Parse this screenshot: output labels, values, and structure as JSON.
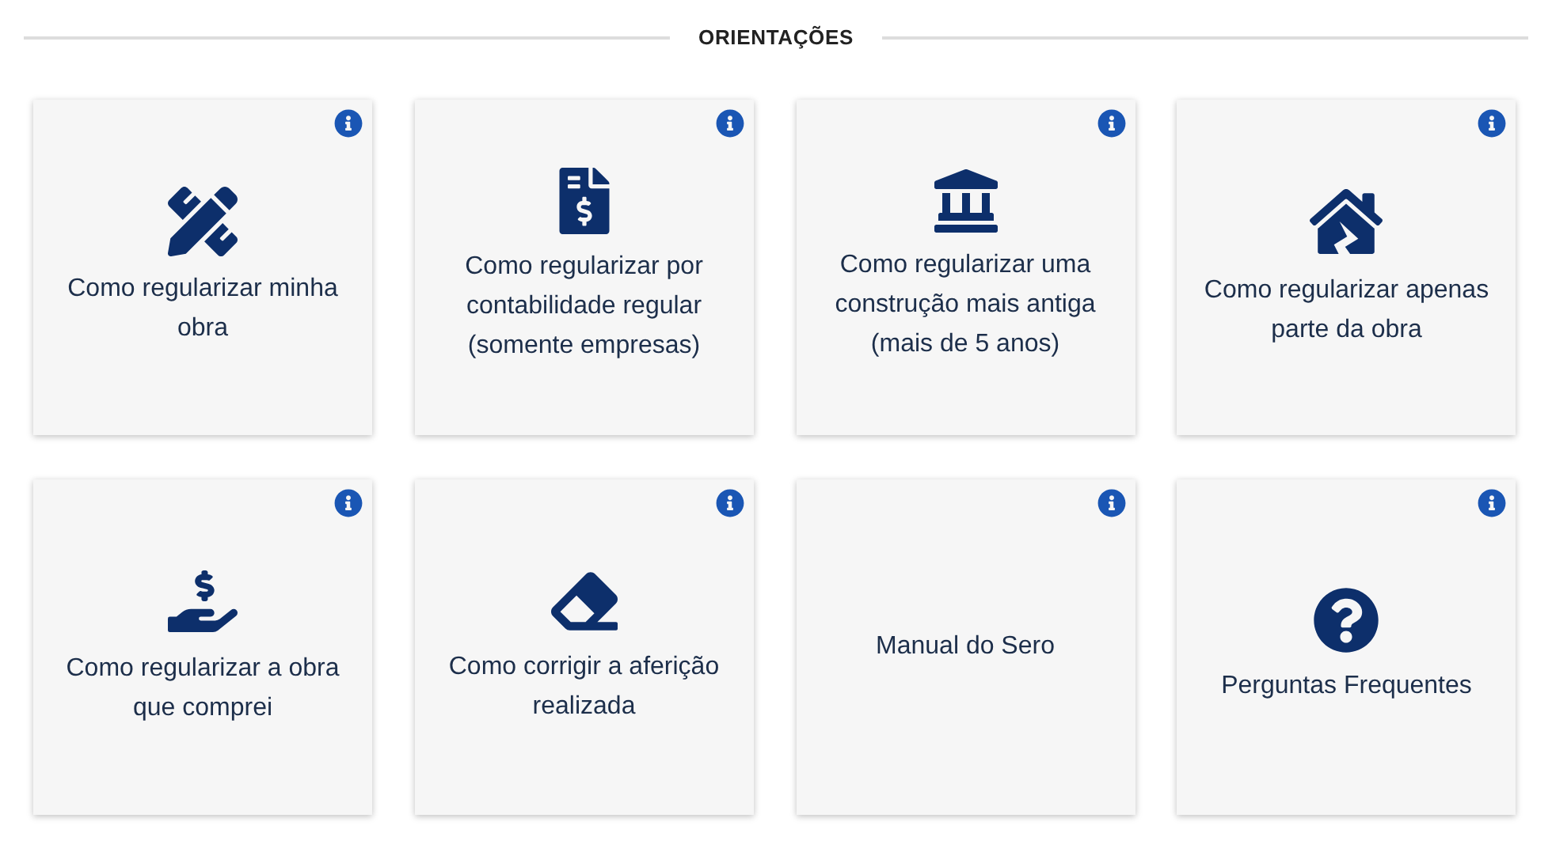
{
  "heading": "ORIENTAÇÕES",
  "cards": [
    {
      "kind": "tools",
      "label": "Como regularizar minha obra"
    },
    {
      "kind": "invoice",
      "label": "Como regularizar por contabilidade regular (somente empresas)"
    },
    {
      "kind": "building",
      "label": "Como regularizar uma construção mais antiga (mais de 5 anos)"
    },
    {
      "kind": "house",
      "label": "Como regularizar apenas parte da obra"
    },
    {
      "kind": "hand",
      "label": "Como regularizar a obra que comprei"
    },
    {
      "kind": "eraser",
      "label": "Como corrigir a aferição realizada"
    },
    {
      "kind": "none",
      "label": "Manual do Sero"
    },
    {
      "kind": "question",
      "label": "Perguntas Frequentes"
    }
  ]
}
